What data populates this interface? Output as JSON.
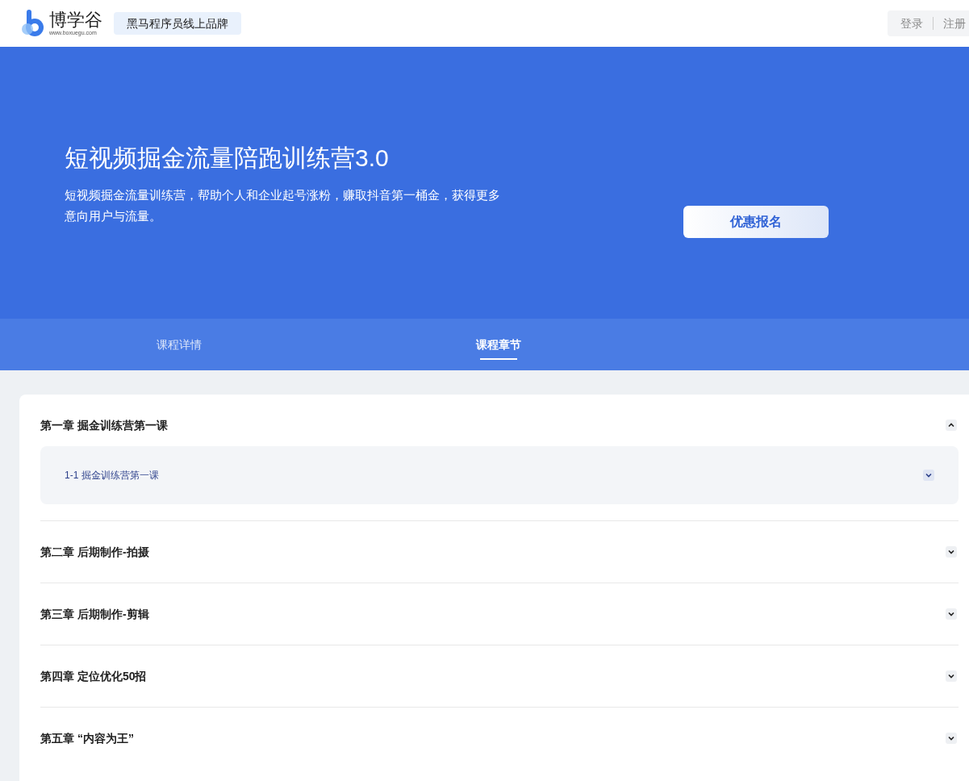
{
  "header": {
    "logo_text": "博学谷",
    "logo_url": "www.boxuegu.com",
    "brand_tag": "黑马程序员线上品牌",
    "login": "登录",
    "register": "注册"
  },
  "hero": {
    "title": "短视频掘金流量陪跑训练营3.0",
    "description": "短视频掘金流量训练营，帮助个人和企业起号涨粉，赚取抖音第一桶金，获得更多意向用户与流量。",
    "button": "优惠报名"
  },
  "tabs": [
    {
      "label": "课程详情",
      "selected": false
    },
    {
      "label": "课程章节",
      "selected": true
    }
  ],
  "chapters": [
    {
      "title": "第一章 掘金训练营第一课",
      "expanded": true,
      "lessons": [
        {
          "title": "1-1 掘金训练营第一课",
          "expanded": false
        }
      ]
    },
    {
      "title": "第二章 后期制作-拍摄",
      "expanded": false
    },
    {
      "title": "第三章 后期制作-剪辑",
      "expanded": false
    },
    {
      "title": "第四章 定位优化50招",
      "expanded": false
    },
    {
      "title": "第五章 “内容为王”",
      "expanded": false
    }
  ]
}
